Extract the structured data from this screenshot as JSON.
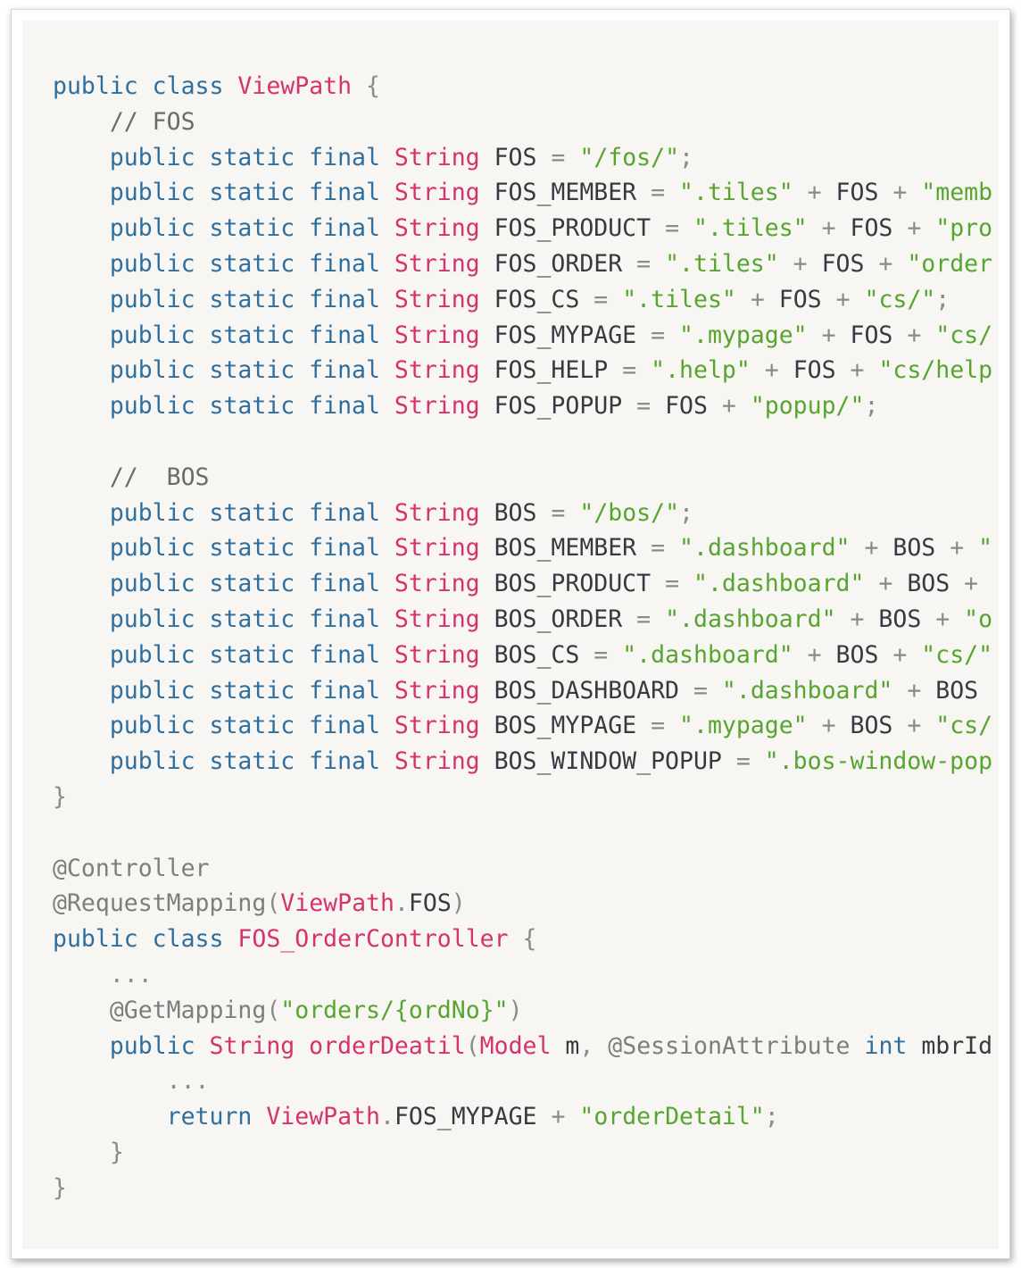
{
  "lines": [
    {
      "tokens": [
        {
          "t": "kw",
          "v": "public class "
        },
        {
          "t": "type",
          "v": "ViewPath"
        },
        {
          "t": "op",
          "v": " {"
        }
      ]
    },
    {
      "tokens": [
        {
          "t": "cm",
          "v": "    // FOS"
        }
      ]
    },
    {
      "tokens": [
        {
          "t": "kw",
          "v": "    public static final "
        },
        {
          "t": "type",
          "v": "String"
        },
        {
          "t": "pl",
          "v": " FOS "
        },
        {
          "t": "op",
          "v": "="
        },
        {
          "t": "pl",
          "v": " "
        },
        {
          "t": "str",
          "v": "\"/fos/\""
        },
        {
          "t": "op",
          "v": ";"
        }
      ]
    },
    {
      "tokens": [
        {
          "t": "kw",
          "v": "    public static final "
        },
        {
          "t": "type",
          "v": "String"
        },
        {
          "t": "pl",
          "v": " FOS_MEMBER "
        },
        {
          "t": "op",
          "v": "="
        },
        {
          "t": "pl",
          "v": " "
        },
        {
          "t": "str",
          "v": "\".tiles\""
        },
        {
          "t": "op",
          "v": " + "
        },
        {
          "t": "pl",
          "v": "FOS"
        },
        {
          "t": "op",
          "v": " + "
        },
        {
          "t": "str",
          "v": "\"memb"
        }
      ]
    },
    {
      "tokens": [
        {
          "t": "kw",
          "v": "    public static final "
        },
        {
          "t": "type",
          "v": "String"
        },
        {
          "t": "pl",
          "v": " FOS_PRODUCT "
        },
        {
          "t": "op",
          "v": "="
        },
        {
          "t": "pl",
          "v": " "
        },
        {
          "t": "str",
          "v": "\".tiles\""
        },
        {
          "t": "op",
          "v": " + "
        },
        {
          "t": "pl",
          "v": "FOS"
        },
        {
          "t": "op",
          "v": " + "
        },
        {
          "t": "str",
          "v": "\"pro"
        }
      ]
    },
    {
      "tokens": [
        {
          "t": "kw",
          "v": "    public static final "
        },
        {
          "t": "type",
          "v": "String"
        },
        {
          "t": "pl",
          "v": " FOS_ORDER "
        },
        {
          "t": "op",
          "v": "="
        },
        {
          "t": "pl",
          "v": " "
        },
        {
          "t": "str",
          "v": "\".tiles\""
        },
        {
          "t": "op",
          "v": " + "
        },
        {
          "t": "pl",
          "v": "FOS"
        },
        {
          "t": "op",
          "v": " + "
        },
        {
          "t": "str",
          "v": "\"order"
        }
      ]
    },
    {
      "tokens": [
        {
          "t": "kw",
          "v": "    public static final "
        },
        {
          "t": "type",
          "v": "String"
        },
        {
          "t": "pl",
          "v": " FOS_CS "
        },
        {
          "t": "op",
          "v": "="
        },
        {
          "t": "pl",
          "v": " "
        },
        {
          "t": "str",
          "v": "\".tiles\""
        },
        {
          "t": "op",
          "v": " + "
        },
        {
          "t": "pl",
          "v": "FOS"
        },
        {
          "t": "op",
          "v": " + "
        },
        {
          "t": "str",
          "v": "\"cs/\""
        },
        {
          "t": "op",
          "v": ";"
        }
      ]
    },
    {
      "tokens": [
        {
          "t": "kw",
          "v": "    public static final "
        },
        {
          "t": "type",
          "v": "String"
        },
        {
          "t": "pl",
          "v": " FOS_MYPAGE "
        },
        {
          "t": "op",
          "v": "="
        },
        {
          "t": "pl",
          "v": " "
        },
        {
          "t": "str",
          "v": "\".mypage\""
        },
        {
          "t": "op",
          "v": " + "
        },
        {
          "t": "pl",
          "v": "FOS"
        },
        {
          "t": "op",
          "v": " + "
        },
        {
          "t": "str",
          "v": "\"cs/"
        }
      ]
    },
    {
      "tokens": [
        {
          "t": "kw",
          "v": "    public static final "
        },
        {
          "t": "type",
          "v": "String"
        },
        {
          "t": "pl",
          "v": " FOS_HELP "
        },
        {
          "t": "op",
          "v": "="
        },
        {
          "t": "pl",
          "v": " "
        },
        {
          "t": "str",
          "v": "\".help\""
        },
        {
          "t": "op",
          "v": " + "
        },
        {
          "t": "pl",
          "v": "FOS"
        },
        {
          "t": "op",
          "v": " + "
        },
        {
          "t": "str",
          "v": "\"cs/help"
        }
      ]
    },
    {
      "tokens": [
        {
          "t": "kw",
          "v": "    public static final "
        },
        {
          "t": "type",
          "v": "String"
        },
        {
          "t": "pl",
          "v": " FOS_POPUP "
        },
        {
          "t": "op",
          "v": "="
        },
        {
          "t": "pl",
          "v": " FOS"
        },
        {
          "t": "op",
          "v": " + "
        },
        {
          "t": "str",
          "v": "\"popup/\""
        },
        {
          "t": "op",
          "v": ";"
        }
      ]
    },
    {
      "tokens": []
    },
    {
      "tokens": [
        {
          "t": "cm",
          "v": "    //  BOS"
        }
      ]
    },
    {
      "tokens": [
        {
          "t": "kw",
          "v": "    public static final "
        },
        {
          "t": "type",
          "v": "String"
        },
        {
          "t": "pl",
          "v": " BOS "
        },
        {
          "t": "op",
          "v": "="
        },
        {
          "t": "pl",
          "v": " "
        },
        {
          "t": "str",
          "v": "\"/bos/\""
        },
        {
          "t": "op",
          "v": ";"
        }
      ]
    },
    {
      "tokens": [
        {
          "t": "kw",
          "v": "    public static final "
        },
        {
          "t": "type",
          "v": "String"
        },
        {
          "t": "pl",
          "v": " BOS_MEMBER "
        },
        {
          "t": "op",
          "v": "="
        },
        {
          "t": "pl",
          "v": " "
        },
        {
          "t": "str",
          "v": "\".dashboard\""
        },
        {
          "t": "op",
          "v": " + "
        },
        {
          "t": "pl",
          "v": "BOS"
        },
        {
          "t": "op",
          "v": " + "
        },
        {
          "t": "str",
          "v": "\""
        }
      ]
    },
    {
      "tokens": [
        {
          "t": "kw",
          "v": "    public static final "
        },
        {
          "t": "type",
          "v": "String"
        },
        {
          "t": "pl",
          "v": " BOS_PRODUCT "
        },
        {
          "t": "op",
          "v": "="
        },
        {
          "t": "pl",
          "v": " "
        },
        {
          "t": "str",
          "v": "\".dashboard\""
        },
        {
          "t": "op",
          "v": " + "
        },
        {
          "t": "pl",
          "v": "BOS"
        },
        {
          "t": "op",
          "v": " +"
        }
      ]
    },
    {
      "tokens": [
        {
          "t": "kw",
          "v": "    public static final "
        },
        {
          "t": "type",
          "v": "String"
        },
        {
          "t": "pl",
          "v": " BOS_ORDER "
        },
        {
          "t": "op",
          "v": "="
        },
        {
          "t": "pl",
          "v": " "
        },
        {
          "t": "str",
          "v": "\".dashboard\""
        },
        {
          "t": "op",
          "v": " + "
        },
        {
          "t": "pl",
          "v": "BOS"
        },
        {
          "t": "op",
          "v": " + "
        },
        {
          "t": "str",
          "v": "\"o"
        }
      ]
    },
    {
      "tokens": [
        {
          "t": "kw",
          "v": "    public static final "
        },
        {
          "t": "type",
          "v": "String"
        },
        {
          "t": "pl",
          "v": " BOS_CS "
        },
        {
          "t": "op",
          "v": "="
        },
        {
          "t": "pl",
          "v": " "
        },
        {
          "t": "str",
          "v": "\".dashboard\""
        },
        {
          "t": "op",
          "v": " + "
        },
        {
          "t": "pl",
          "v": "BOS"
        },
        {
          "t": "op",
          "v": " + "
        },
        {
          "t": "str",
          "v": "\"cs/\""
        }
      ]
    },
    {
      "tokens": [
        {
          "t": "kw",
          "v": "    public static final "
        },
        {
          "t": "type",
          "v": "String"
        },
        {
          "t": "pl",
          "v": " BOS_DASHBOARD "
        },
        {
          "t": "op",
          "v": "="
        },
        {
          "t": "pl",
          "v": " "
        },
        {
          "t": "str",
          "v": "\".dashboard\""
        },
        {
          "t": "op",
          "v": " + "
        },
        {
          "t": "pl",
          "v": "BOS"
        }
      ]
    },
    {
      "tokens": [
        {
          "t": "kw",
          "v": "    public static final "
        },
        {
          "t": "type",
          "v": "String"
        },
        {
          "t": "pl",
          "v": " BOS_MYPAGE "
        },
        {
          "t": "op",
          "v": "="
        },
        {
          "t": "pl",
          "v": " "
        },
        {
          "t": "str",
          "v": "\".mypage\""
        },
        {
          "t": "op",
          "v": " + "
        },
        {
          "t": "pl",
          "v": "BOS"
        },
        {
          "t": "op",
          "v": " + "
        },
        {
          "t": "str",
          "v": "\"cs/"
        }
      ]
    },
    {
      "tokens": [
        {
          "t": "kw",
          "v": "    public static final "
        },
        {
          "t": "type",
          "v": "String"
        },
        {
          "t": "pl",
          "v": " BOS_WINDOW_POPUP "
        },
        {
          "t": "op",
          "v": "="
        },
        {
          "t": "pl",
          "v": " "
        },
        {
          "t": "str",
          "v": "\".bos-window-pop"
        }
      ]
    },
    {
      "tokens": [
        {
          "t": "op",
          "v": "}"
        }
      ]
    },
    {
      "tokens": []
    },
    {
      "tokens": [
        {
          "t": "an",
          "v": "@Controller"
        }
      ]
    },
    {
      "tokens": [
        {
          "t": "an",
          "v": "@RequestMapping"
        },
        {
          "t": "op",
          "v": "("
        },
        {
          "t": "type",
          "v": "ViewPath"
        },
        {
          "t": "op",
          "v": "."
        },
        {
          "t": "pl",
          "v": "FOS"
        },
        {
          "t": "op",
          "v": ")"
        }
      ]
    },
    {
      "tokens": [
        {
          "t": "kw",
          "v": "public class "
        },
        {
          "t": "type",
          "v": "FOS_OrderController"
        },
        {
          "t": "op",
          "v": " {"
        }
      ]
    },
    {
      "tokens": [
        {
          "t": "op",
          "v": "    ..."
        }
      ]
    },
    {
      "tokens": [
        {
          "t": "an",
          "v": "    @GetMapping"
        },
        {
          "t": "op",
          "v": "("
        },
        {
          "t": "str",
          "v": "\"orders/{ordNo}\""
        },
        {
          "t": "op",
          "v": ")"
        }
      ]
    },
    {
      "tokens": [
        {
          "t": "kw",
          "v": "    public "
        },
        {
          "t": "type",
          "v": "String orderDeatil"
        },
        {
          "t": "op",
          "v": "("
        },
        {
          "t": "type",
          "v": "Model"
        },
        {
          "t": "pl",
          "v": " m"
        },
        {
          "t": "op",
          "v": ", "
        },
        {
          "t": "an",
          "v": "@SessionAttribute"
        },
        {
          "t": "pl",
          "v": " "
        },
        {
          "t": "kw",
          "v": "int"
        },
        {
          "t": "pl",
          "v": " mbrId"
        }
      ]
    },
    {
      "tokens": [
        {
          "t": "op",
          "v": "        ..."
        }
      ]
    },
    {
      "tokens": [
        {
          "t": "kw",
          "v": "        return "
        },
        {
          "t": "type",
          "v": "ViewPath"
        },
        {
          "t": "op",
          "v": "."
        },
        {
          "t": "pl",
          "v": "FOS_MYPAGE"
        },
        {
          "t": "op",
          "v": " + "
        },
        {
          "t": "str",
          "v": "\"orderDetail\""
        },
        {
          "t": "op",
          "v": ";"
        }
      ]
    },
    {
      "tokens": [
        {
          "t": "op",
          "v": "    }"
        }
      ]
    },
    {
      "tokens": [
        {
          "t": "op",
          "v": "}"
        }
      ]
    }
  ]
}
